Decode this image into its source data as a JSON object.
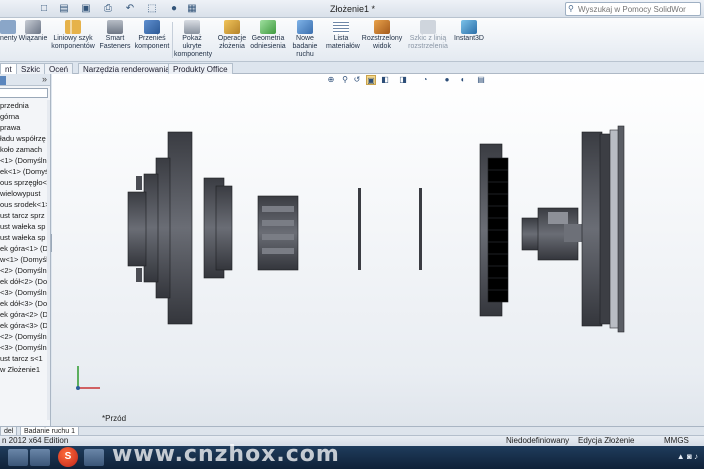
{
  "titlebar": {
    "doc_title": "Złożenie1 *",
    "search_placeholder": "Wyszukaj w Pomocy SolidWorks"
  },
  "ribbon": {
    "buttons": [
      {
        "label": "nenty"
      },
      {
        "label": "Wiązanie"
      },
      {
        "label": "Liniowy szyk komponentów"
      },
      {
        "label": "Smart Fasteners"
      },
      {
        "label": "Przenieś komponent"
      },
      {
        "label": "Pokaż ukryte komponenty"
      },
      {
        "label": "Operacje złożenia"
      },
      {
        "label": "Geometria odniesienia"
      },
      {
        "label": "Nowe badanie ruchu"
      },
      {
        "label": "Lista materiałów"
      },
      {
        "label": "Rozstrzelony widok"
      },
      {
        "label": "Szkic z linią rozstrzelenia"
      },
      {
        "label": "Instant3D"
      }
    ]
  },
  "tabs": [
    "nt",
    "Szkic",
    "Oceń",
    "Narzędzia renderowania",
    "Produkty Office"
  ],
  "feature_tree": [
    "przednia",
    "górna",
    "prawa",
    "ładu współrzę",
    "koło zamach",
    "<1> (Domyśln",
    "ek<1> (Domyśl",
    "ous sprzęgło<",
    "wielowypust",
    "ous srodek<1>",
    "ust tarcz sprz",
    "ust wałeka sp",
    "ust wałeka sp",
    "ek góra<1> (D",
    "w<1> (Domyśl",
    "<2> (Domyśln",
    "ek dół<2> (Do",
    "<3> (Domyśln",
    "ek dół<3> (Do",
    "ek góra<2> (D",
    "ek góra<3> (D",
    "<2> (Domyśln",
    "<3> (Domyśln",
    "ust tarcz s<1",
    "w Złożenie1"
  ],
  "viewport": {
    "orientation_label": "*Przód"
  },
  "bottom_tabs": [
    "del",
    "Badanie ruchu 1"
  ],
  "status": {
    "version": "n 2012 x64 Edition",
    "state": "Niedodefiniowany",
    "mode": "Edycja Złożenie",
    "units": "MMGS"
  },
  "watermark": "www.cnzhox.com",
  "colors": {
    "part_dark": "#3e4046",
    "part_mid": "#5a5c63",
    "accent": "#2b5d9a"
  }
}
